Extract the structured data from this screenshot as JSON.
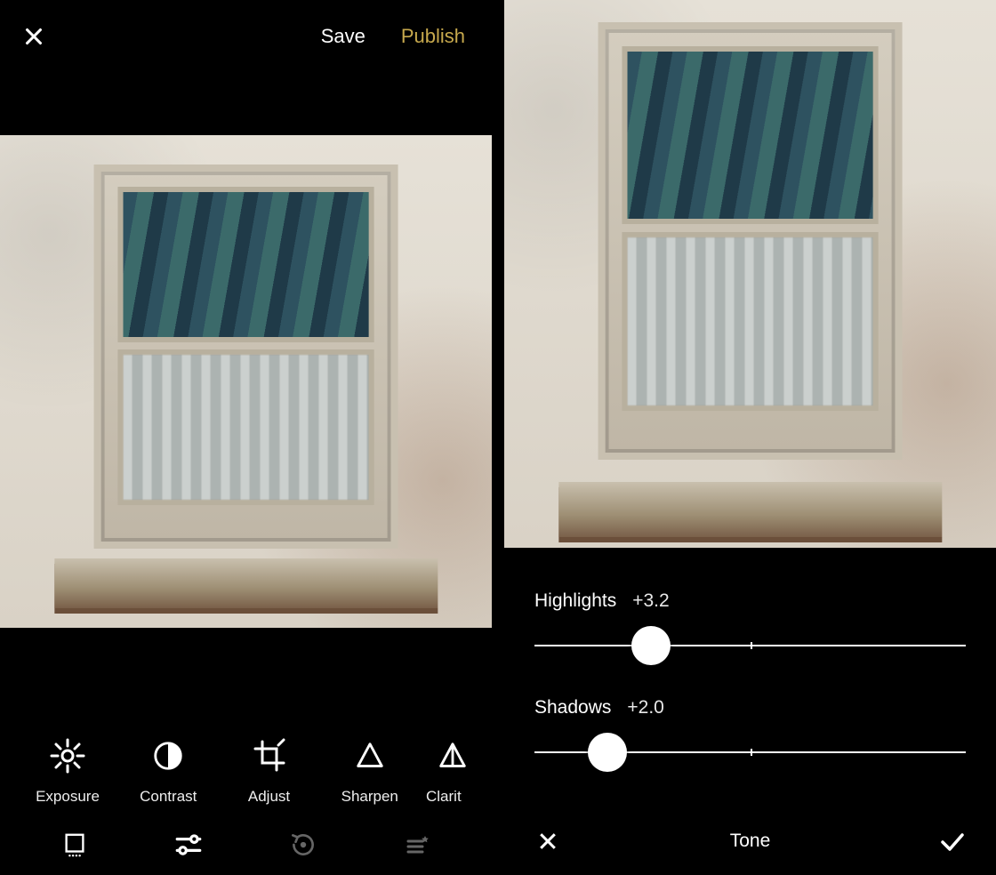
{
  "left": {
    "topbar": {
      "save_label": "Save",
      "publish_label": "Publish"
    },
    "tools": [
      {
        "id": "exposure",
        "label": "Exposure"
      },
      {
        "id": "contrast",
        "label": "Contrast"
      },
      {
        "id": "adjust",
        "label": "Adjust"
      },
      {
        "id": "sharpen",
        "label": "Sharpen"
      },
      {
        "id": "clarity",
        "label": "Clarit"
      }
    ]
  },
  "right": {
    "sliders": {
      "highlights": {
        "label": "Highlights",
        "value": "+3.2",
        "percent": 27
      },
      "shadows": {
        "label": "Shadows",
        "value": "+2.0",
        "percent": 17
      }
    },
    "panel_title": "Tone"
  },
  "colors": {
    "accent": "#c7a94d"
  }
}
